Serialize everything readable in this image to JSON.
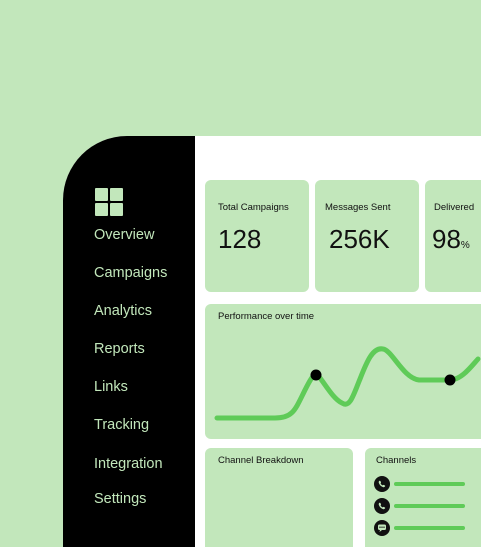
{
  "sidebar": {
    "items": [
      {
        "label": "Overview"
      },
      {
        "label": "Campaigns"
      },
      {
        "label": "Analytics"
      },
      {
        "label": "Reports"
      },
      {
        "label": "Links"
      },
      {
        "label": "Tracking"
      },
      {
        "label": "Integration"
      },
      {
        "label": "Settings"
      }
    ]
  },
  "stats": [
    {
      "label": "Total Campaigns",
      "value": "128"
    },
    {
      "label": "Messages Sent",
      "value": "256K"
    },
    {
      "label": "Delivered",
      "value": "98",
      "unit": "%"
    }
  ],
  "performance": {
    "title": "Performance over time"
  },
  "channel_breakdown": {
    "title": "Channel Breakdown"
  },
  "channels": {
    "title": "Channels",
    "items": [
      {
        "icon": "whatsapp-icon"
      },
      {
        "icon": "whatsapp-icon"
      },
      {
        "icon": "chat-bubble-icon"
      }
    ]
  },
  "colors": {
    "background": "#c2e7bb",
    "sidebar": "#000000",
    "accent_line": "#5fcb58",
    "card": "#c2e7bb"
  }
}
